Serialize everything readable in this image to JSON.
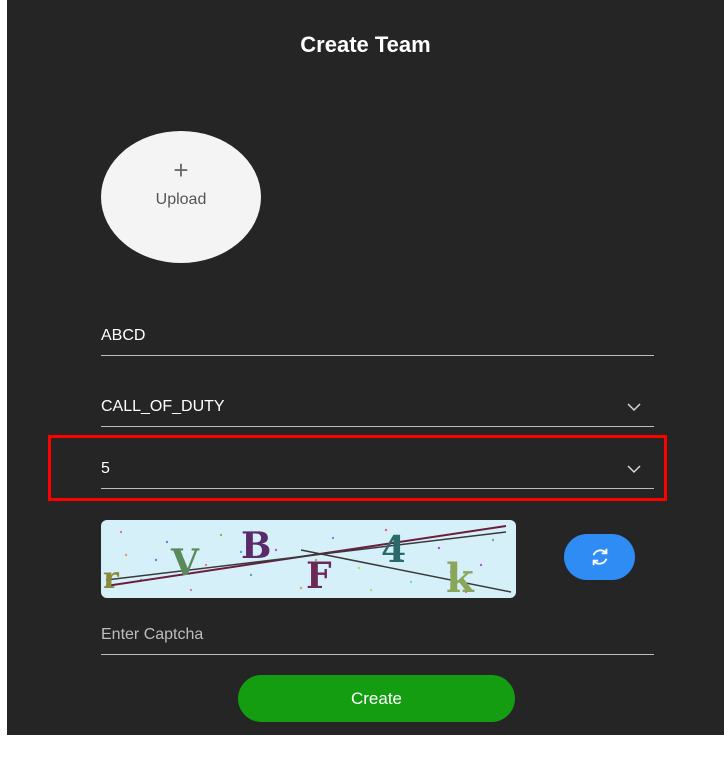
{
  "dialog": {
    "title": "Create Team"
  },
  "upload": {
    "plus": "+",
    "label": "Upload"
  },
  "team_name": {
    "value": "ABCD"
  },
  "game_select": {
    "value": "CALL_OF_DUTY"
  },
  "team_size_select": {
    "value": "5"
  },
  "captcha": {
    "chars": [
      "r",
      "V",
      "B",
      "F",
      "4",
      "k"
    ],
    "input_placeholder": "Enter Captcha"
  },
  "create_button": {
    "label": "Create"
  },
  "colors": {
    "panel_bg": "#252525",
    "create_button": "#159d11",
    "refresh_button": "#2f8cf4",
    "highlight": "#ff0000"
  }
}
